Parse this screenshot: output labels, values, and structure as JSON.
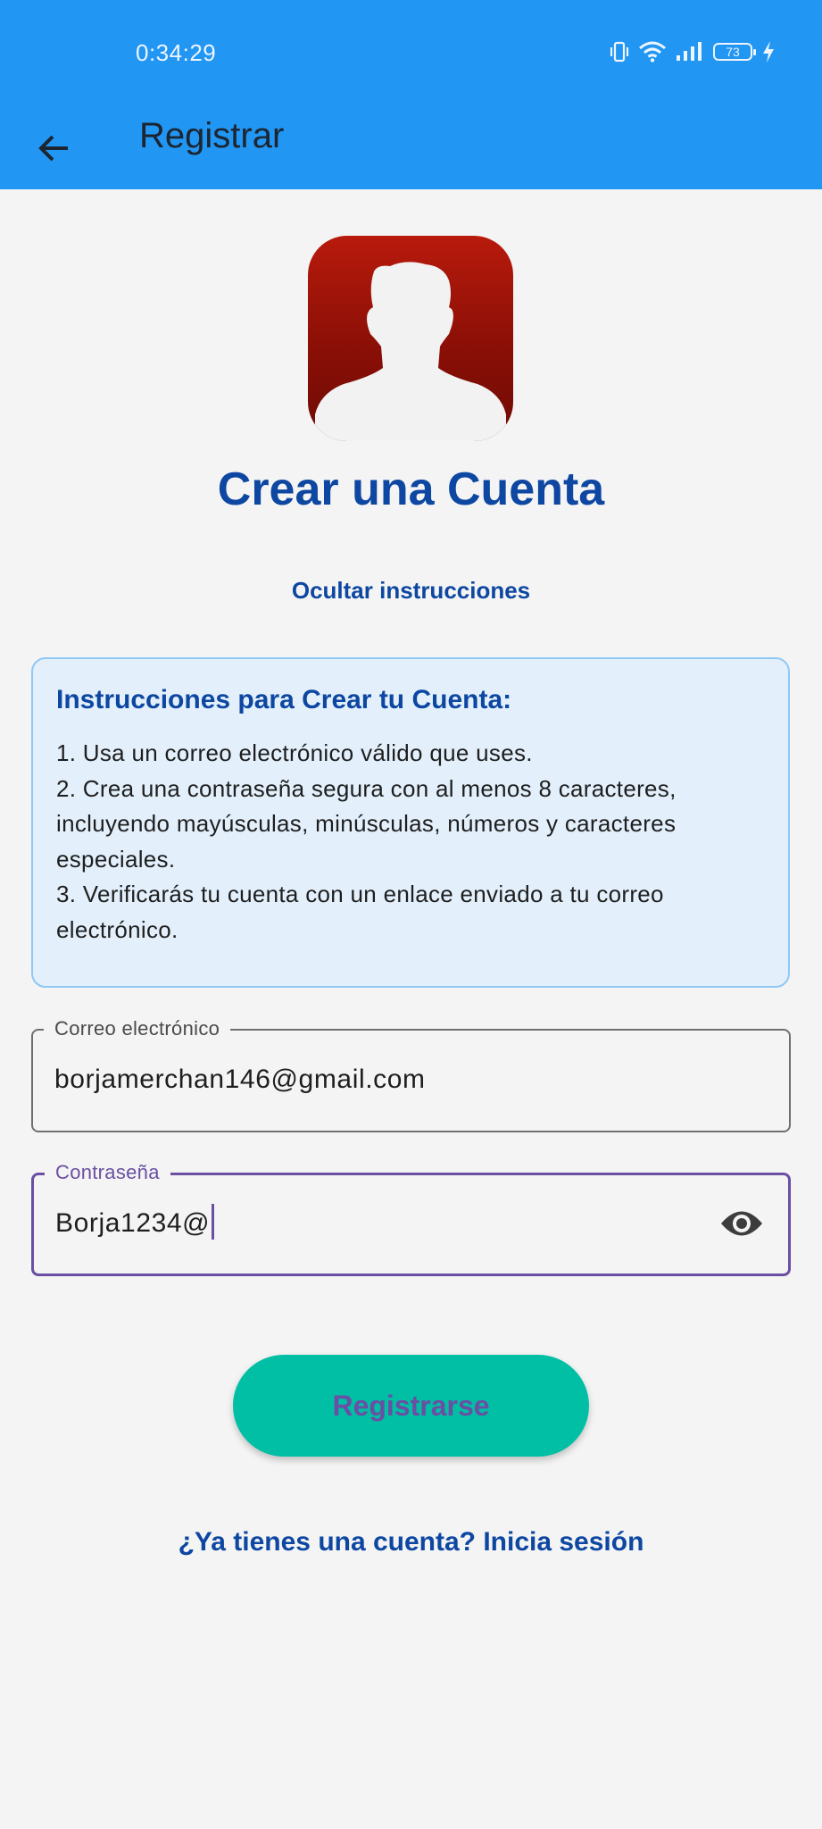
{
  "status_bar": {
    "time": "0:34:29",
    "battery_level": "73",
    "icons": [
      "vibrate-icon",
      "wifi-icon",
      "signal-icon",
      "battery-icon",
      "charging-bolt-icon"
    ]
  },
  "app_bar": {
    "back_icon": "back-arrow-icon",
    "title": "Registrar"
  },
  "logo": {
    "icon": "user-silhouette-icon"
  },
  "page": {
    "title": "Crear una Cuenta",
    "toggle_instructions": "Ocultar instrucciones"
  },
  "instructions": {
    "title": "Instrucciones para Crear tu Cuenta:",
    "lines": [
      "1. Usa un correo electrónico válido que uses.",
      "2. Crea una contraseña segura con al menos 8 caracteres,",
      "incluyendo mayúsculas, minúsculas, números y caracteres",
      "especiales.",
      "3. Verificarás tu cuenta con un enlace enviado a tu correo",
      "electrónico."
    ]
  },
  "form": {
    "email": {
      "label": "Correo electrónico",
      "value": "borjamerchan146@gmail.com"
    },
    "password": {
      "label": "Contraseña",
      "value": "Borja1234@",
      "visibility_icon": "eye-icon"
    },
    "submit_label": "Registrarse",
    "login_link": "¿Ya tienes una cuenta? Inicia sesión"
  },
  "colors": {
    "app_bar": "#2196f3",
    "title": "#0d47a1",
    "button": "#00bfa5",
    "focus": "#6a4fa3",
    "instructions_bg": "#e3f0fc"
  }
}
